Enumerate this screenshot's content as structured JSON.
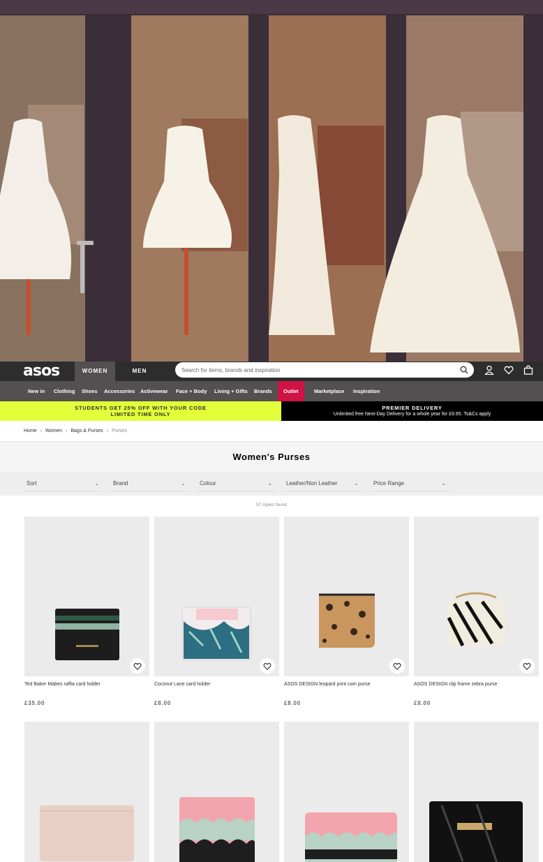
{
  "header": {
    "logo": "asos",
    "tabs": [
      "WOMEN",
      "MEN"
    ],
    "search_placeholder": "Search for items, brands and inspiration"
  },
  "nav": {
    "items": [
      "New in",
      "Clothing",
      "Shoes",
      "Accessories",
      "Activewear",
      "Face + Body",
      "Living + Gifts",
      "Brands",
      "Outlet",
      "Marketplace",
      "Inspiration"
    ],
    "highlight_color": "#d01345"
  },
  "promos": {
    "students_line1": "STUDENTS GET 25% OFF WITH YOUR CODE",
    "students_line2": "LIMITED TIME ONLY",
    "premier_title": "PREMIER DELIVERY",
    "premier_text": "Unlimited free Next-Day Delivery for a whole year for £9.95. Ts&Cs apply"
  },
  "breadcrumb": [
    "Home",
    "Women",
    "Bags & Purses",
    "Purses"
  ],
  "page_title": "Women's Purses",
  "filters": [
    "Sort",
    "Brand",
    "Colour",
    "Leather/Non Leather",
    "Price Range"
  ],
  "styles_found": "57 styles found",
  "products": [
    {
      "name": "Ted Baker Mabes raffia card holder",
      "price": "£35.00"
    },
    {
      "name": "Coconut Lane card holder",
      "price": "£8.00"
    },
    {
      "name": "ASOS DESIGN leopard print coin purse",
      "price": "£8.00"
    },
    {
      "name": "ASOS DESIGN clip frame zebra purse",
      "price": "£8.00"
    },
    {
      "name": "",
      "price": ""
    },
    {
      "name": "",
      "price": ""
    },
    {
      "name": "",
      "price": ""
    },
    {
      "name": "",
      "price": ""
    }
  ],
  "icons": [
    "search-icon",
    "account-icon",
    "wishlist-icon",
    "bag-icon",
    "chevron-down-icon",
    "heart-icon"
  ]
}
